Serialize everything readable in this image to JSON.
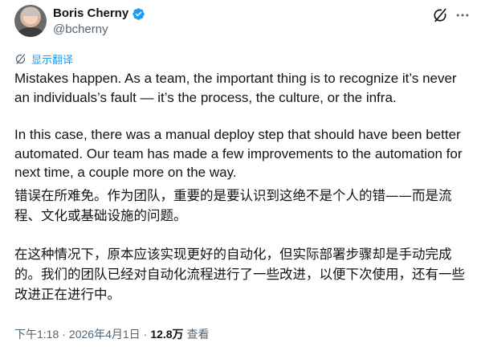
{
  "author": {
    "display_name": "Boris Cherny",
    "handle": "@bcherny"
  },
  "actions": {
    "grok_icon": "grok-icon",
    "more_icon": "more-icon"
  },
  "translate": {
    "label": "显示翻译",
    "icon": "grok-translate-icon"
  },
  "tweet": {
    "paragraphs_en": [
      "Mistakes happen. As a team, the important thing is to recognize it’s never an individuals’s fault — it’s the process, the culture, or the infra.",
      "In this case, there was a manual deploy step that should have been better automated. Our team has made a few improvements to the automation for next time, a couple more on the way."
    ],
    "paragraphs_zh": [
      "错误在所难免。作为团队，重要的是要认识到这绝不是个人的错——而是流程、文化或基础设施的问题。",
      "在这种情况下，原本应该实现更好的自动化，但实际部署步骤却是手动完成的。我们的团队已经对自动化流程进行了一些改进，以便下次使用，还有一些改进正在进行中。"
    ]
  },
  "meta": {
    "time": "下午1:18",
    "separator": "·",
    "date": "2026年4月1日",
    "views_count": "12.8万",
    "views_label": "查看"
  },
  "colors": {
    "accent": "#1d9bf0",
    "text": "#0f1419",
    "secondary": "#536471"
  }
}
